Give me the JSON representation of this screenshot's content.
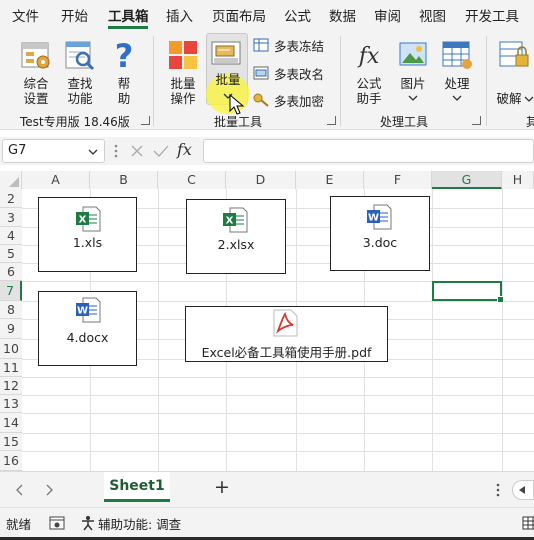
{
  "menu_tabs": [
    "文件",
    "开始",
    "工具箱",
    "插入",
    "页面布局",
    "公式",
    "数据",
    "审阅",
    "视图",
    "开发工具"
  ],
  "ribbon": {
    "btn_settings": [
      "综合",
      "设置"
    ],
    "btn_lookup": [
      "查找",
      "功能"
    ],
    "btn_help": [
      "帮",
      "助"
    ],
    "group1_label": "Test专用版 18.46版",
    "btn_batch_op": [
      "批量",
      "操作"
    ],
    "btn_batch": "批量",
    "small_freeze": "多表冻结",
    "small_rename": "多表改名",
    "small_encrypt": "多表加密",
    "group2_label": "批量工具",
    "btn_formula": [
      "公式",
      "助手"
    ],
    "btn_image": "图片",
    "btn_process": "处理",
    "group3_label": "处理工具",
    "btn_crack": "破解",
    "group4_label": "其"
  },
  "formula_bar": {
    "name_box": "G7",
    "fx_label": "fx",
    "value": ""
  },
  "columns": [
    "A",
    "B",
    "C",
    "D",
    "E",
    "F",
    "G",
    "H"
  ],
  "rows": [
    "2",
    "3",
    "4",
    "5",
    "6",
    "7",
    "8",
    "9",
    "10",
    "11",
    "12",
    "13",
    "14",
    "15",
    "16"
  ],
  "selected_cell": "G7",
  "embedded_files": [
    {
      "name": "1.xls",
      "type": "excel"
    },
    {
      "name": "2.xlsx",
      "type": "excel"
    },
    {
      "name": "3.doc",
      "type": "word"
    },
    {
      "name": "4.docx",
      "type": "word"
    },
    {
      "name": "Excel必备工具箱使用手册.pdf",
      "type": "pdf"
    }
  ],
  "sheet_tabs": {
    "active": "Sheet1",
    "add_label": "+"
  },
  "status_bar": {
    "ready": "就绪",
    "accessibility": "辅助功能: 调查"
  },
  "colors": {
    "accent": "#1e7b44",
    "excel_green": "#1e7b44",
    "word_blue": "#2b5fb8",
    "pdf_red": "#d83a2f",
    "highlight": "#faf53c"
  }
}
